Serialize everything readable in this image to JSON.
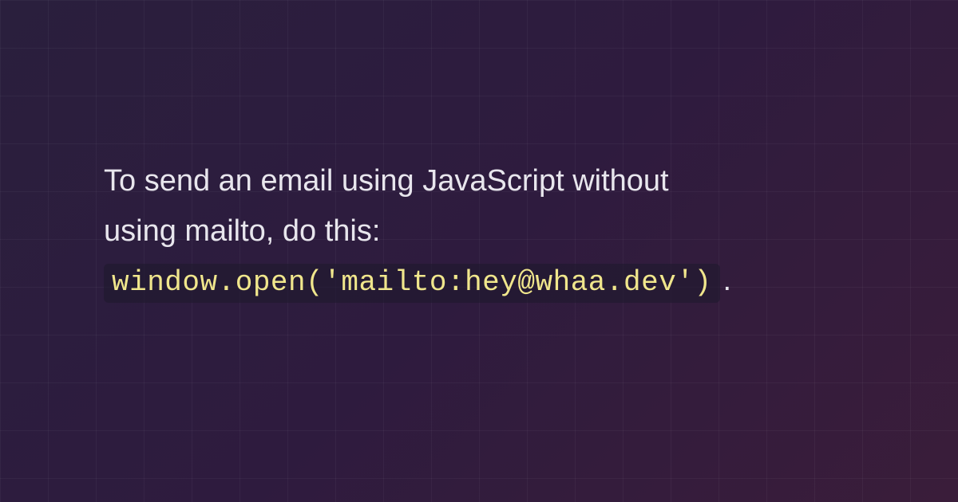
{
  "content": {
    "intro_line1": "To send an email using JavaScript without",
    "intro_line2": "using mailto, do this:",
    "code_snippet": "window.open('mailto:hey@whaa.dev')",
    "period": "."
  }
}
